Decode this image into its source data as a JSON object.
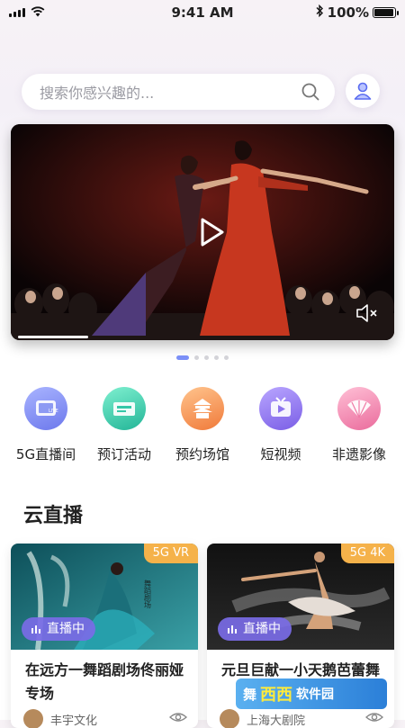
{
  "status_bar": {
    "time": "9:41 AM",
    "battery": "100%",
    "battery_level": 1.0
  },
  "search": {
    "placeholder": "搜索你感兴趣的..."
  },
  "banner": {
    "page_count": 5,
    "active_page": 0,
    "progress": 0.19
  },
  "entries": [
    {
      "label": "5G直播间",
      "icon": "live-room-icon",
      "color": "#7f8cf0"
    },
    {
      "label": "预订活动",
      "icon": "ticket-icon",
      "color": "#35c7a8"
    },
    {
      "label": "预约场馆",
      "icon": "temple-icon",
      "color": "#f6944d"
    },
    {
      "label": "短视频",
      "icon": "tv-icon",
      "color": "#8d74ee"
    },
    {
      "label": "非遗影像",
      "icon": "fan-icon",
      "color": "#ef7aa6"
    }
  ],
  "section": {
    "title": "云直播"
  },
  "cards": [
    {
      "tag": "5G VR",
      "live": "直播中",
      "title": "在远方一舞蹈剧场佟丽娅专场",
      "author": "丰宇文化"
    },
    {
      "tag": "5G 4K",
      "live": "直播中",
      "title": "元旦巨献一小天鹅芭蕾舞",
      "author": "上海大剧院"
    }
  ],
  "watermark": {
    "a": "舞",
    "b": "西西",
    "c": "软件园"
  },
  "colors": {
    "accent": "#7b8ff7",
    "live_badge": "#7a6be6",
    "tag": "#f5b24a"
  }
}
